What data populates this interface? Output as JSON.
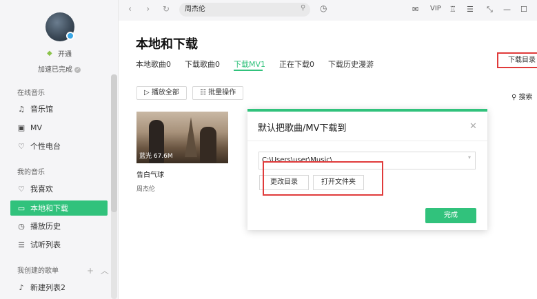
{
  "sidebar": {
    "vip_label": "开通",
    "speed_label": "加速已完成",
    "sections": {
      "online": "在线音乐",
      "mine": "我的音乐",
      "created": "我创建的歌单"
    },
    "online_items": [
      {
        "label": "音乐馆",
        "icon": "music-hall-icon"
      },
      {
        "label": "MV",
        "icon": "video-icon"
      },
      {
        "label": "个性电台",
        "icon": "radio-icon"
      }
    ],
    "mine_items": [
      {
        "label": "我喜欢",
        "icon": "heart-icon"
      },
      {
        "label": "本地和下载",
        "icon": "monitor-icon"
      },
      {
        "label": "播放历史",
        "icon": "clock-icon"
      },
      {
        "label": "试听列表",
        "icon": "list-icon"
      }
    ],
    "created_items": [
      {
        "label": "新建列表2",
        "icon": "note-icon"
      }
    ]
  },
  "topbar": {
    "search_value": "周杰伦",
    "vip": "VIP"
  },
  "main": {
    "title": "本地和下载",
    "tabs": [
      "本地歌曲0",
      "下载歌曲0",
      "下载MV1",
      "正在下载0",
      "下载历史漫游"
    ],
    "download_dir_label": "下载目录",
    "play_all": "播放全部",
    "batch": "批量操作",
    "search": "搜索",
    "mv": {
      "badge": "蓝光 67.6M",
      "title": "告白气球",
      "artist": "周杰伦"
    }
  },
  "dialog": {
    "title": "默认把歌曲/MV下载到",
    "path": "C:\\Users\\user\\Music\\",
    "change_dir": "更改目录",
    "open_folder": "打开文件夹",
    "done": "完成"
  },
  "colors": {
    "accent": "#31c27c",
    "highlight_box": "#e03a3a"
  }
}
